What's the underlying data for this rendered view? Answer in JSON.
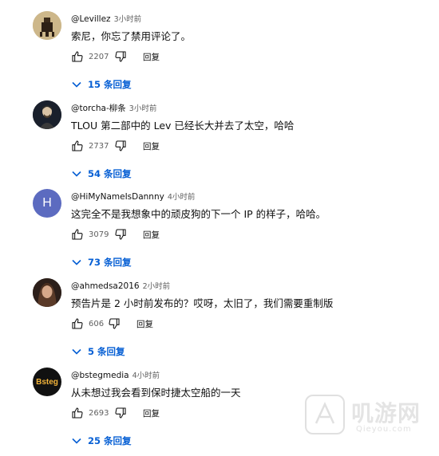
{
  "comments": [
    {
      "author": "@Levillez",
      "time": "3小时前",
      "text": "索尼，你忘了禁用评论了。",
      "likes": "2207",
      "reply_label": "回复",
      "replies_label": "15 条回复"
    },
    {
      "author": "@torcha-柳条",
      "time": "3小时前",
      "text": "TLOU 第二部中的 Lev 已经长大并去了太空，哈哈",
      "likes": "2737",
      "reply_label": "回复",
      "replies_label": "54 条回复"
    },
    {
      "author": "@HiMyNameIsDannny",
      "time": "4小时前",
      "text": "这完全不是我想象中的顽皮狗的下一个 IP 的样子，哈哈。",
      "likes": "3079",
      "reply_label": "回复",
      "replies_label": "73 条回复",
      "avatar_letter": "H",
      "avatar_color": "#5c6bc0"
    },
    {
      "author": "@ahmedsa2016",
      "time": "2小时前",
      "text": "预告片是 2 小时前发布的？哎呀，太旧了，我们需要重制版",
      "likes": "606",
      "reply_label": "回复",
      "replies_label": "5 条回复"
    },
    {
      "author": "@bstegmedia",
      "time": "4小时前",
      "text": "从未想过我会看到保时捷太空船的一天",
      "likes": "2693",
      "reply_label": "回复",
      "replies_label": "25 条回复",
      "avatar_letter": "Bsteg",
      "avatar_color": "#111111"
    }
  ],
  "watermark": {
    "name": "叽游网",
    "url": "Qieyou.com"
  },
  "colors": {
    "link_blue": "#065fd4",
    "secondary_text": "#606060"
  }
}
